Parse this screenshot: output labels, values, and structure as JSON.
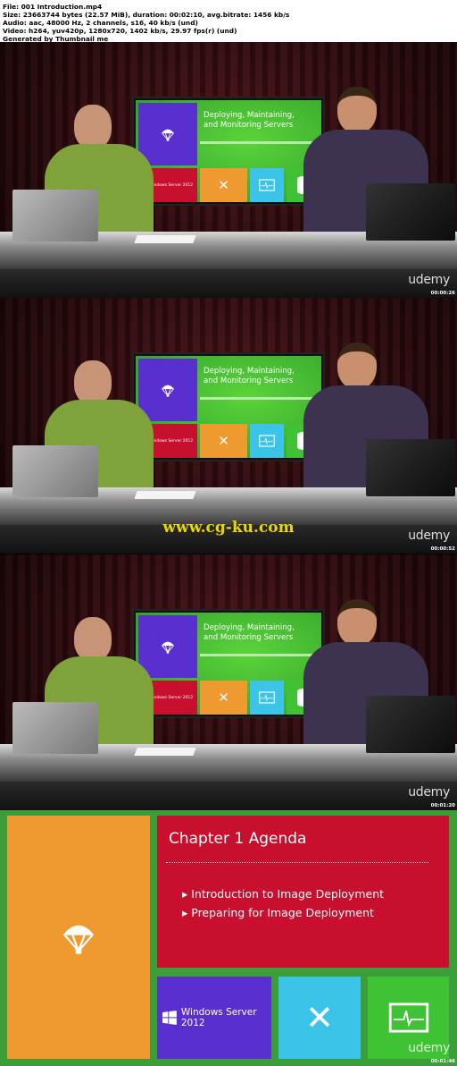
{
  "header": {
    "lines": [
      "File: 001 Introduction.mp4",
      "Size: 23663744 bytes (22.57 MiB), duration: 00:02:10, avg.bitrate: 1456 kb/s",
      "Audio: aac, 48000 Hz, 2 channels, s16, 40 kb/s (und)",
      "Video: h264, yuv420p, 1280x720, 1402 kb/s, 29.97 fps(r) (und)",
      "Generated by Thumbnail me"
    ]
  },
  "slide": {
    "title_line1": "Deploying, Maintaining,",
    "title_line2": "and Monitoring Servers",
    "windows_label": "Windows Server 2012"
  },
  "brand": "udemy",
  "timestamps": [
    "00:00:26",
    "00:00:52",
    "00:01:20",
    "00:01:46"
  ],
  "watermark": "www.cg-ku.com",
  "agenda": {
    "title": "Chapter 1 Agenda",
    "items": [
      "Introduction to Image Deployment",
      "Preparing for Image Deployment"
    ],
    "windows_label": "Windows Server 2012"
  },
  "colors": {
    "purple": "#5a2fd0",
    "red": "#c8102e",
    "orange": "#ef9a2e",
    "teal": "#3cc4e8",
    "green": "#3fc234",
    "bg_green": "#3b9e38"
  },
  "icons": [
    "parachute-icon",
    "windows-logo-icon",
    "tools-icon",
    "heart-monitor-icon",
    "database-icon"
  ]
}
